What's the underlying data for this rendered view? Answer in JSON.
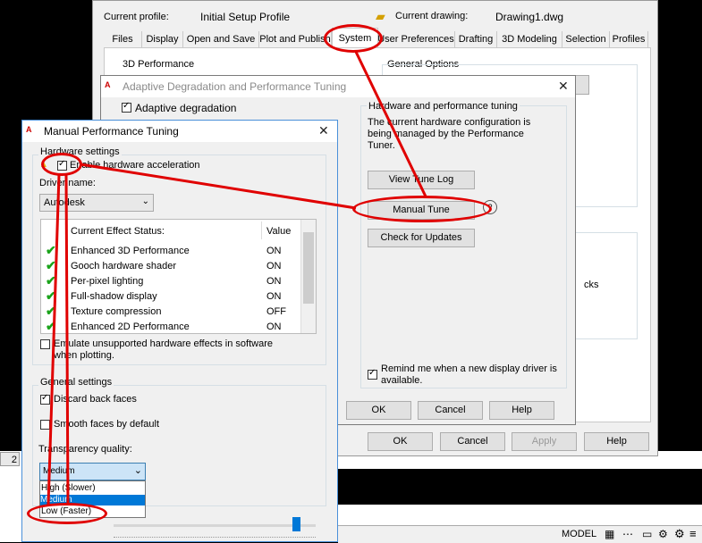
{
  "options": {
    "current_profile_label": "Current profile:",
    "current_profile_value": "Initial Setup Profile",
    "current_drawing_label": "Current drawing:",
    "current_drawing_value": "Drawing1.dwg",
    "tabs": [
      "Files",
      "Display",
      "Open and Save",
      "Plot and Publish",
      "System",
      "User Preferences",
      "Drafting",
      "3D Modeling",
      "Selection",
      "Profiles"
    ],
    "group_3d_performance": "3D Performance",
    "group_general_options": "General Options",
    "buttons": {
      "ok": "OK",
      "cancel": "Cancel",
      "apply": "Apply",
      "help": "Help"
    },
    "partial_text_cks": "cks"
  },
  "adaptive": {
    "title": "Adaptive Degradation and Performance Tuning",
    "adaptive_degradation": "Adaptive degradation",
    "hw_group": "Hardware and performance tuning",
    "hw_text": "The current hardware configuration is being managed by the Performance Tuner.",
    "view_tune_log": "View Tune Log",
    "manual_tune": "Manual Tune",
    "check_updates": "Check for Updates",
    "remind": "Remind me when a new display driver is available.",
    "ok": "OK",
    "cancel": "Cancel",
    "help": "Help"
  },
  "manual": {
    "title": "Manual Performance Tuning",
    "hardware_settings": "Hardware settings",
    "enable_hw": "Enable hardware acceleration",
    "driver_name_label": "Driver name:",
    "driver_value": "Autodesk",
    "status_header": "Current Effect Status:",
    "value_header": "Value",
    "effects": [
      {
        "name": "Enhanced 3D Performance",
        "value": "ON"
      },
      {
        "name": "Gooch hardware shader",
        "value": "ON"
      },
      {
        "name": "Per-pixel lighting",
        "value": "ON"
      },
      {
        "name": "Full-shadow display",
        "value": "ON"
      },
      {
        "name": "Texture compression",
        "value": "OFF"
      },
      {
        "name": "Enhanced 2D Performance",
        "value": "ON"
      }
    ],
    "emulate": "Emulate unsupported hardware effects in software when plotting.",
    "general_settings": "General settings",
    "discard_back_faces": "Discard back faces",
    "smooth_faces": "Smooth faces by default",
    "transparency_label": "Transparency quality:",
    "transparency_value": "Medium",
    "transparency_options": [
      "High (Slower)",
      "Medium",
      "Low (Faster)"
    ]
  },
  "statusbar": {
    "model": "MODEL",
    "layout_tab": "2"
  }
}
